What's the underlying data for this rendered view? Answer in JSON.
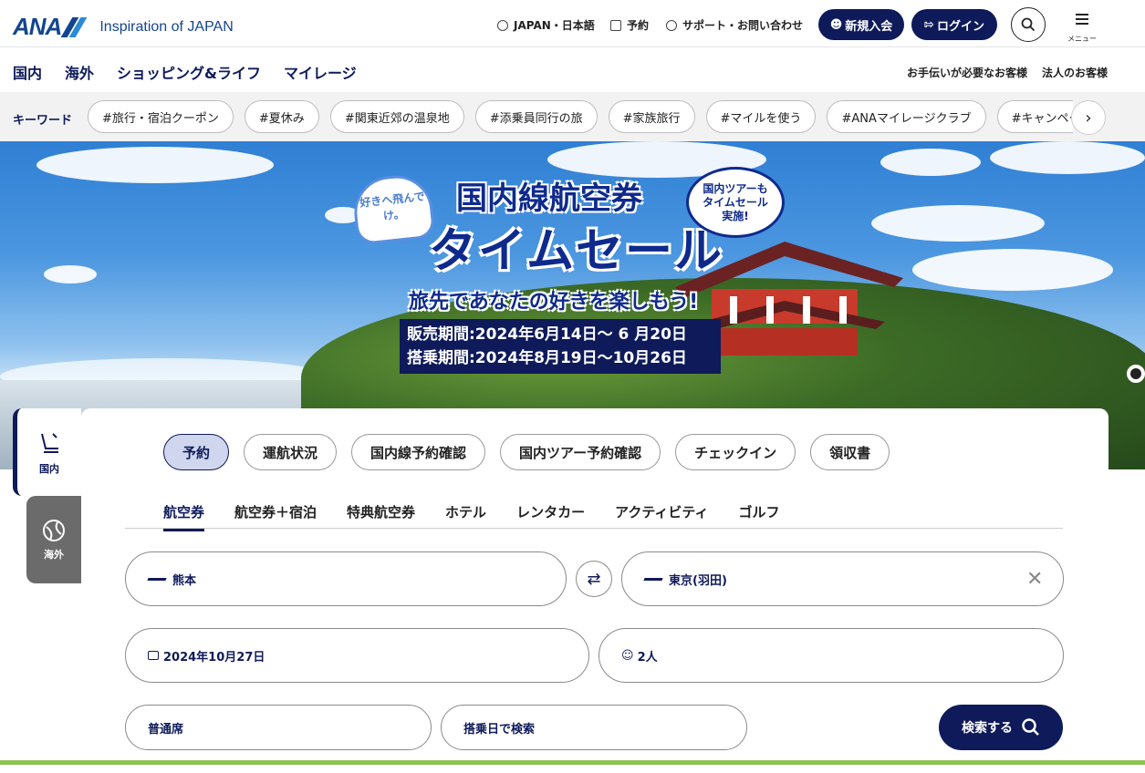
{
  "header": {
    "logo_text": "ANA",
    "tagline": "Inspiration of JAPAN",
    "language": "JAPAN・日本語",
    "reservation": "予約",
    "support": "サポート・お問い合わせ",
    "signup": "新規入会",
    "login": "ログイン",
    "menu": "メニュー"
  },
  "nav": {
    "items": [
      "国内",
      "海外",
      "ショッピング&ライフ",
      "マイレージ"
    ],
    "right": [
      "お手伝いが必要なお客様",
      "法人のお客様"
    ]
  },
  "keywords": {
    "label": "キーワード",
    "chips": [
      "#旅行・宿泊クーポン",
      "#夏休み",
      "#関東近郊の温泉地",
      "#添乗員同行の旅",
      "#家族旅行",
      "#マイルを使う",
      "#ANAマイレージクラブ",
      "#キャンペーン"
    ]
  },
  "banner": {
    "heart": "好きへ飛んでけ。",
    "title": "国内線航空券",
    "main": "タイムセール",
    "bubble": "国内ツアーも タイムセール 実施!",
    "sub": "旅先であなたの好きを楽しもう!",
    "sale_period": "販売期間:2024年6月14日〜 6 月20日",
    "flight_period": "搭乗期間:2024年8月19日〜10月26日"
  },
  "side": {
    "domestic": "国内",
    "international": "海外"
  },
  "tabs_primary": [
    "予約",
    "運航状況",
    "国内線予約確認",
    "国内ツアー予約確認",
    "チェックイン",
    "領収書"
  ],
  "tabs_secondary": [
    "航空券",
    "航空券＋宿泊",
    "特典航空券",
    "ホテル",
    "レンタカー",
    "アクティビティ",
    "ゴルフ"
  ],
  "form": {
    "from": "熊本",
    "to": "東京(羽田)",
    "date": "2024年10月27日",
    "passengers": "2人",
    "seat_class": "普通席",
    "search_mode": "搭乗日で検索",
    "search_button": "検索する"
  }
}
